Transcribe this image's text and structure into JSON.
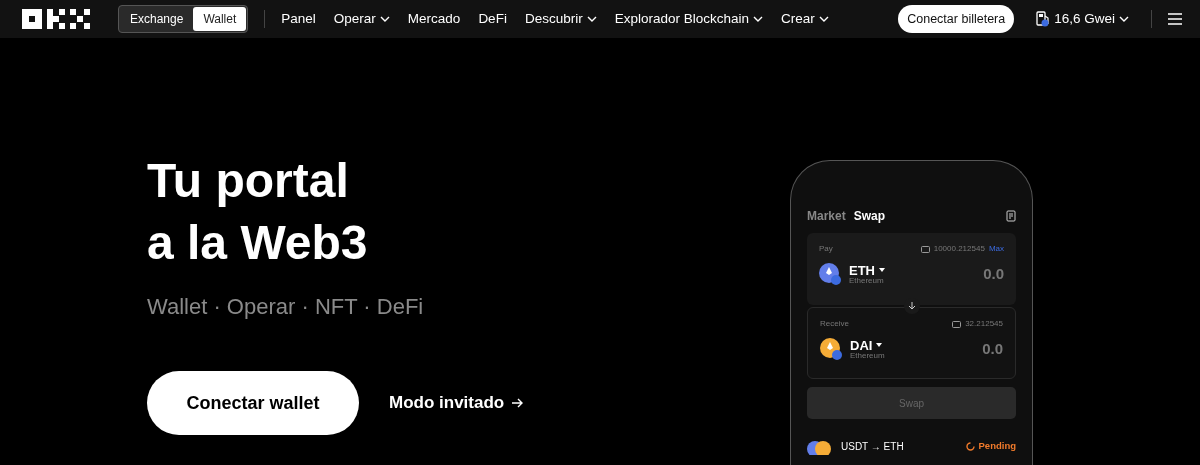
{
  "nav": {
    "mode_tabs": [
      {
        "label": "Exchange",
        "selected": false
      },
      {
        "label": "Wallet",
        "selected": true
      }
    ],
    "menu": [
      {
        "label": "Panel",
        "dropdown": false
      },
      {
        "label": "Operar",
        "dropdown": true
      },
      {
        "label": "Mercado",
        "dropdown": false
      },
      {
        "label": "DeFi",
        "dropdown": false
      },
      {
        "label": "Descubrir",
        "dropdown": true
      },
      {
        "label": "Explorador Blockchain",
        "dropdown": true
      },
      {
        "label": "Crear",
        "dropdown": true
      }
    ],
    "connect_button": "Conectar billetera",
    "gas": "16,6 Gwei"
  },
  "hero": {
    "title_lines": [
      "Tu portal",
      "a la Web3"
    ],
    "tagline": "Wallet · Operar · NFT · DeFi",
    "primary_button": "Conectar wallet",
    "guest_link": "Modo invitado"
  },
  "phone": {
    "tabs": [
      {
        "label": "Market",
        "selected": false
      },
      {
        "label": "Swap",
        "selected": true
      }
    ],
    "cards": [
      {
        "label": "Pay",
        "balance": "10000.212545",
        "max": "Max",
        "token": "ETH",
        "network": "Ethereum",
        "amount": "0.0",
        "color": "#627eea"
      },
      {
        "label": "Receive",
        "balance": "32.212545",
        "token": "DAI",
        "network": "Ethereum",
        "amount": "0.0",
        "color": "#f5ac37"
      }
    ],
    "swap_button": {
      "label": "Swap",
      "disabled": true
    },
    "activity": {
      "pair": "USDT → ETH",
      "status": "Pending"
    }
  }
}
